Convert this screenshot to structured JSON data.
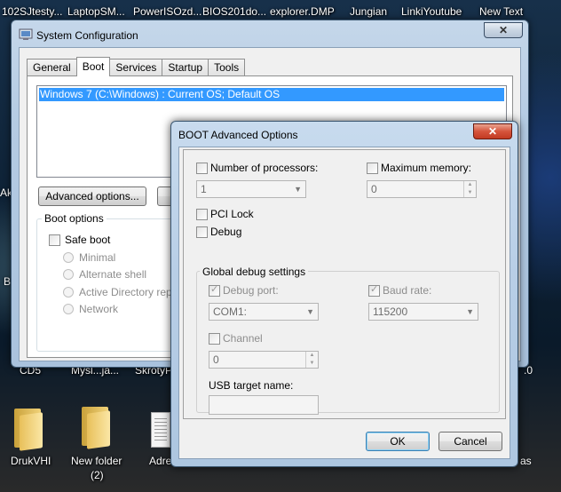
{
  "desktop": {
    "top_labels": [
      "102SJtesty...",
      "LaptopSM...",
      "PowerISOzd...",
      "BIOS201do...",
      "explorer.DMP",
      "Jungian",
      "LinkiYoutube",
      "New Text"
    ],
    "side_labels": {
      "ak": "Ak",
      "b": "B",
      "zero": ".0",
      "as": "as"
    },
    "row2_labels": [
      "CD5",
      "Mysl...ja...",
      "SkrotyP..."
    ],
    "icons": [
      {
        "label": "DrukVHI",
        "sub": ""
      },
      {
        "label": "New folder",
        "sub": "(2)"
      },
      {
        "label": "Adre",
        "sub": ""
      }
    ]
  },
  "sysconfig": {
    "title": "System Configuration",
    "close_label": "✕",
    "tabs": [
      "General",
      "Boot",
      "Services",
      "Startup",
      "Tools"
    ],
    "active_tab": "Boot",
    "os_entries": [
      "Windows 7 (C:\\Windows) : Current OS; Default OS"
    ],
    "advanced_button": "Advanced options...",
    "boot_options": {
      "legend": "Boot options",
      "safe_boot": "Safe boot",
      "minimal": "Minimal",
      "alternate_shell": "Alternate shell",
      "ad_repair": "Active Directory repai",
      "network": "Network"
    }
  },
  "boot_advanced": {
    "title": "BOOT Advanced Options",
    "close_label": "✕",
    "num_processors": {
      "label": "Number of processors:",
      "checked": false,
      "value": "1"
    },
    "max_memory": {
      "label": "Maximum memory:",
      "checked": false,
      "value": "0"
    },
    "pci_lock": {
      "label": "PCI Lock",
      "checked": false
    },
    "debug": {
      "label": "Debug",
      "checked": false
    },
    "global_debug": {
      "legend": "Global debug settings",
      "debug_port": {
        "label": "Debug port:",
        "checked": true,
        "value": "COM1:"
      },
      "baud_rate": {
        "label": "Baud rate:",
        "checked": true,
        "value": "115200"
      },
      "channel": {
        "label": "Channel",
        "checked": false,
        "value": "0"
      },
      "usb_target": {
        "label": "USB target name:",
        "value": ""
      }
    },
    "ok_label": "OK",
    "cancel_label": "Cancel"
  }
}
